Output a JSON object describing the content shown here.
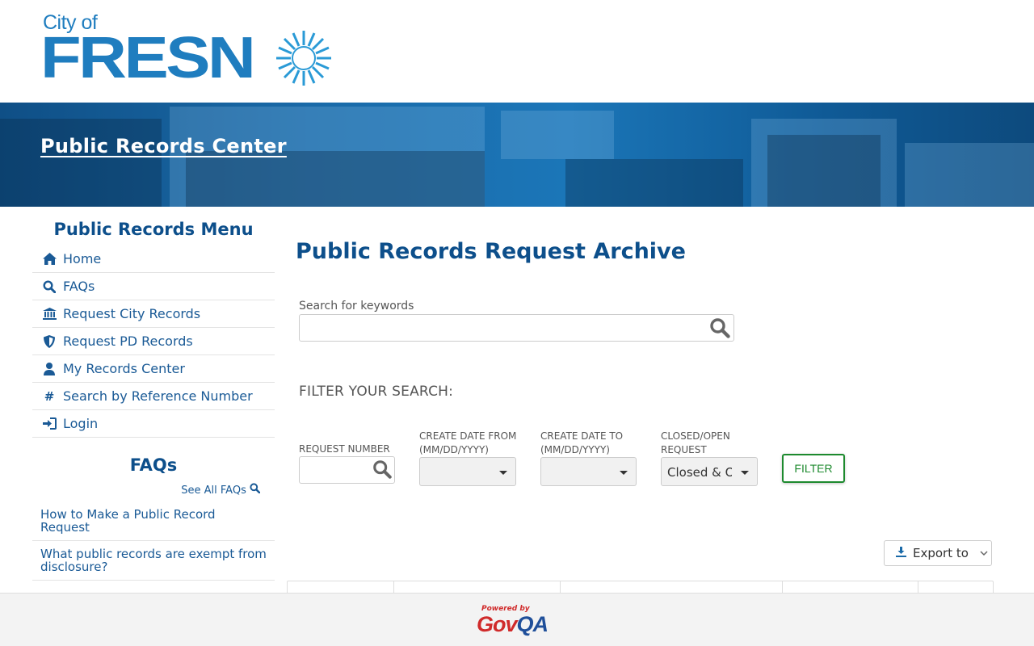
{
  "header": {
    "logo_city_of": "City of",
    "logo_fresno": "FRESN"
  },
  "banner": {
    "title": "Public Records Center"
  },
  "sidebar": {
    "menu_title": "Public Records Menu",
    "items": [
      {
        "label": "Home",
        "icon": "home-icon"
      },
      {
        "label": "FAQs",
        "icon": "search-icon"
      },
      {
        "label": "Request City Records",
        "icon": "bank-icon"
      },
      {
        "label": "Request PD Records",
        "icon": "shield-icon"
      },
      {
        "label": "My Records Center",
        "icon": "user-icon"
      },
      {
        "label": "Search by Reference Number",
        "icon": "hash-icon"
      },
      {
        "label": "Login",
        "icon": "login-icon"
      }
    ],
    "faq_title": "FAQs",
    "see_all": "See All FAQs",
    "faqs": [
      "How to Make a Public Record Request",
      "What public records are exempt from disclosure?"
    ]
  },
  "main": {
    "title": "Public Records Request Archive",
    "keyword_label": "Search for keywords",
    "keyword_value": "",
    "filter_heading": "FILTER YOUR SEARCH:",
    "filters": {
      "request_number_label": "REQUEST NUMBER",
      "date_from_label": "CREATE DATE FROM (MM/DD/YYYY)",
      "date_to_label": "CREATE DATE TO (MM/DD/YYYY)",
      "status_label": "CLOSED/OPEN REQUEST",
      "status_value": "Closed & Open"
    },
    "filter_button": "FILTER",
    "export_button": "Export to"
  },
  "footer": {
    "powered_by": "Powered by",
    "brand_gov": "Gov",
    "brand_qa": "QA"
  },
  "colors": {
    "brand_blue": "#0d4f8b",
    "link_blue": "#1a5a96",
    "filter_green": "#1d8a2e",
    "govqa_red": "#d02a2a"
  }
}
